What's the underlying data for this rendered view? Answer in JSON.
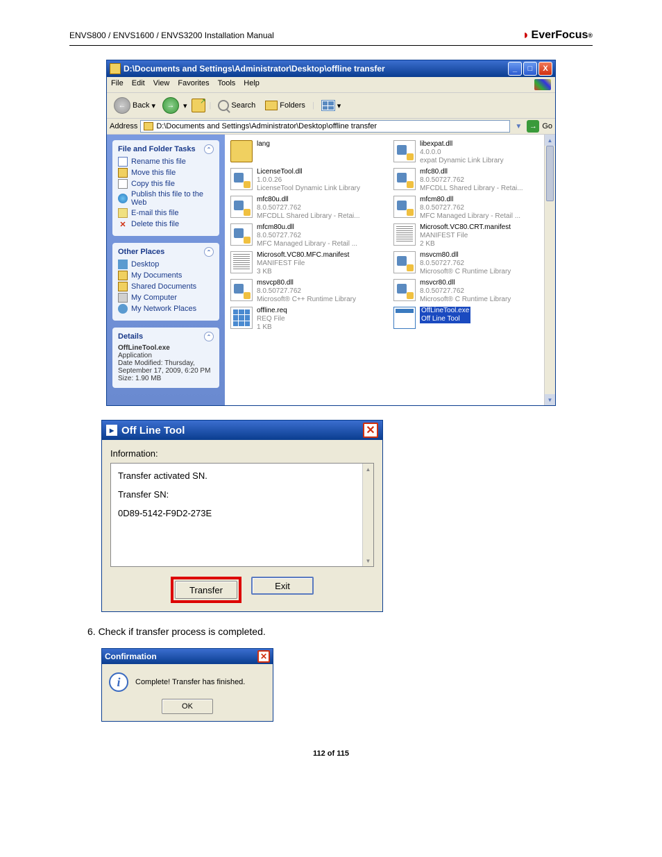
{
  "header": {
    "left": "ENVS800 / ENVS1600 / ENVS3200 Installation Manual",
    "brand": "EverFocus"
  },
  "explorer": {
    "title": "D:\\Documents and Settings\\Administrator\\Desktop\\offline transfer",
    "menu": [
      "File",
      "Edit",
      "View",
      "Favorites",
      "Tools",
      "Help"
    ],
    "toolbar": {
      "back": "Back",
      "search": "Search",
      "folders": "Folders"
    },
    "address": {
      "label": "Address",
      "path": "D:\\Documents and Settings\\Administrator\\Desktop\\offline transfer",
      "go": "Go"
    },
    "side": {
      "tasks": {
        "title": "File and Folder Tasks",
        "items": [
          "Rename this file",
          "Move this file",
          "Copy this file",
          "Publish this file to the Web",
          "E-mail this file",
          "Delete this file"
        ]
      },
      "places": {
        "title": "Other Places",
        "items": [
          "Desktop",
          "My Documents",
          "Shared Documents",
          "My Computer",
          "My Network Places"
        ]
      },
      "details": {
        "title": "Details",
        "name": "OffLineTool.exe",
        "type": "Application",
        "modified": "Date Modified: Thursday, September 17, 2009, 6:20 PM",
        "size": "Size: 1.90 MB"
      }
    },
    "files": [
      {
        "name": "lang",
        "l2": "",
        "l3": "",
        "icon": "folder"
      },
      {
        "name": "libexpat.dll",
        "l2": "4.0.0.0",
        "l3": "expat Dynamic Link Library",
        "icon": "dll"
      },
      {
        "name": "LicenseTool.dll",
        "l2": "1.0.0.26",
        "l3": "LicenseTool Dynamic Link Library",
        "icon": "dll"
      },
      {
        "name": "mfc80.dll",
        "l2": "8.0.50727.762",
        "l3": "MFCDLL Shared Library - Retai...",
        "icon": "dll"
      },
      {
        "name": "mfc80u.dll",
        "l2": "8.0.50727.762",
        "l3": "MFCDLL Shared Library - Retai...",
        "icon": "dll"
      },
      {
        "name": "mfcm80.dll",
        "l2": "8.0.50727.762",
        "l3": "MFC Managed Library - Retail ...",
        "icon": "dll"
      },
      {
        "name": "mfcm80u.dll",
        "l2": "8.0.50727.762",
        "l3": "MFC Managed Library - Retail ...",
        "icon": "dll"
      },
      {
        "name": "Microsoft.VC80.CRT.manifest",
        "l2": "MANIFEST File",
        "l3": "2 KB",
        "icon": "manifest"
      },
      {
        "name": "Microsoft.VC80.MFC.manifest",
        "l2": "MANIFEST File",
        "l3": "3 KB",
        "icon": "manifest"
      },
      {
        "name": "msvcm80.dll",
        "l2": "8.0.50727.762",
        "l3": "Microsoft® C Runtime Library",
        "icon": "dll"
      },
      {
        "name": "msvcp80.dll",
        "l2": "8.0.50727.762",
        "l3": "Microsoft® C++ Runtime Library",
        "icon": "dll"
      },
      {
        "name": "msvcr80.dll",
        "l2": "8.0.50727.762",
        "l3": "Microsoft® C Runtime Library",
        "icon": "dll"
      },
      {
        "name": "offline.req",
        "l2": "REQ File",
        "l3": "1 KB",
        "icon": "reg"
      },
      {
        "name": "OffLineTool.exe",
        "l2": "Off Line Tool",
        "l3": "",
        "icon": "exe",
        "selected": true
      }
    ]
  },
  "offline_tool": {
    "title": "Off Line Tool",
    "info_label": "Information:",
    "text": {
      "l1": "Transfer activated SN.",
      "l2": "Transfer SN:",
      "l3": "0D89-5142-F9D2-273E"
    },
    "buttons": {
      "transfer": "Transfer",
      "exit": "Exit"
    }
  },
  "step6": "6. Check if transfer process is completed.",
  "confirm": {
    "title": "Confirmation",
    "msg": "Complete! Transfer has finished.",
    "ok": "OK"
  },
  "footer": "112 of 115"
}
